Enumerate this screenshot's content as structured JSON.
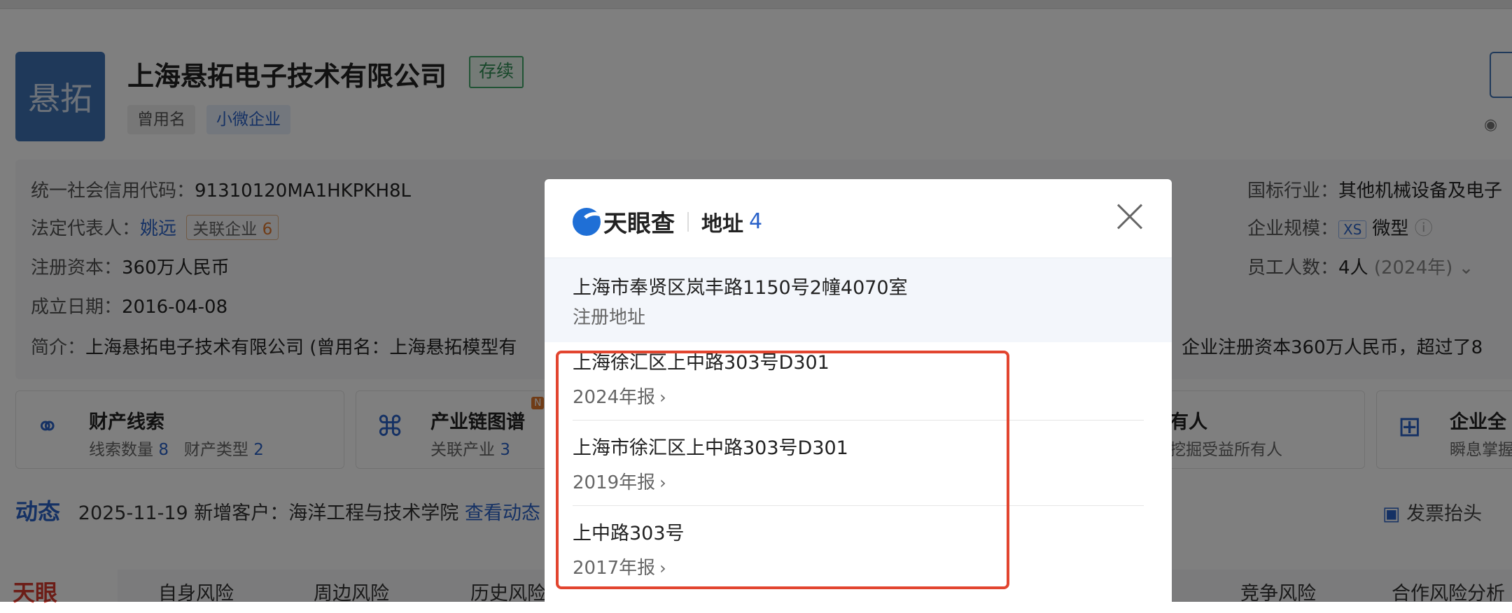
{
  "company": {
    "logo_text": "悬拓",
    "name": "上海悬拓电子技术有限公司",
    "status": "存续",
    "chip_former_name": "曾用名",
    "chip_size": "小微企业"
  },
  "info": {
    "credit_code_label": "统一社会信用代码：",
    "credit_code": "91310120MA1HKPKH8L",
    "legal_rep_label": "法定代表人：",
    "legal_rep": "姚远",
    "related_label": "关联企业",
    "related_count": "6",
    "capital_label": "注册资本：",
    "capital": "360万人民币",
    "founded_label": "成立日期：",
    "founded": "2016-04-08",
    "intro_label": "简介：",
    "intro_left": "上海悬拓电子技术有限公司 (曾用名：上海悬拓模型有",
    "intro_right": "。企业注册资本360万人民币，超过了8",
    "industry_label": "国标行业：",
    "industry": "其他机械设备及电子",
    "scale_label": "企业规模：",
    "scale_tag": "XS",
    "scale": "微型",
    "staff_label": "员工人数：",
    "staff": "4人",
    "staff_year": "(2024年)"
  },
  "cards": [
    {
      "title": "财产线索",
      "sub1_label": "线索数量",
      "sub1_val": "8",
      "sub2_label": "财产类型",
      "sub2_val": "2"
    },
    {
      "title": "产业链图谱",
      "badge": "N",
      "sub1_label": "关联产业",
      "sub1_val": "3"
    },
    {
      "title": "有人",
      "sub": "挖掘受益所有人"
    },
    {
      "title": "企业全",
      "sub": "瞬息掌握"
    }
  ],
  "news": {
    "label": "动态",
    "text": "2025-11-19 新增客户：海洋工程与技术学院",
    "link": "查看动态"
  },
  "invoice": "发票抬头",
  "risk": {
    "logo": "天眼",
    "tabs": [
      "自身风险",
      "周边风险",
      "历史风险",
      "竞争风险",
      "合作风险分析"
    ]
  },
  "modal": {
    "brand": "天眼查",
    "title": "地址",
    "count": "4",
    "primary_address": "上海市奉贤区岚丰路1150号2幢4070室",
    "primary_tag": "注册地址",
    "addresses": [
      {
        "address": "上海徐汇区上中路303号D301",
        "source": "2024年报"
      },
      {
        "address": "上海市徐汇区上中路303号D301",
        "source": "2019年报"
      },
      {
        "address": "上中路303号",
        "source": "2017年报"
      }
    ]
  },
  "colors": {
    "accent": "#2a62c9",
    "highlight": "#e2452f",
    "status_green": "#2f8f55"
  }
}
